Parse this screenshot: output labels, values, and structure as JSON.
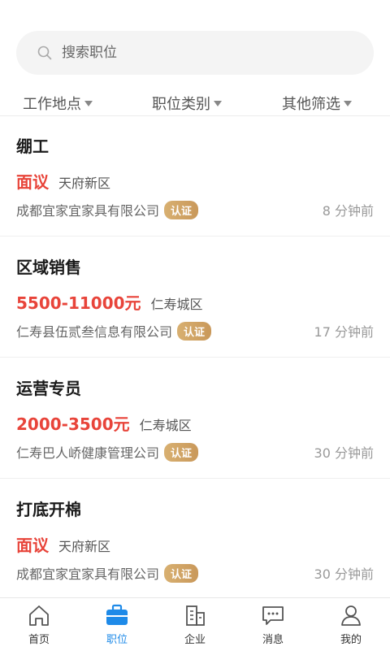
{
  "search": {
    "placeholder": "搜索职位"
  },
  "filters": [
    {
      "label": "工作地点"
    },
    {
      "label": "职位类别"
    },
    {
      "label": "其他筛选"
    }
  ],
  "jobs": [
    {
      "title": "绷工",
      "salary": "面议",
      "area": "天府新区",
      "company": "成都宜家宜家具有限公司",
      "badge": "认证",
      "time": "8 分钟前"
    },
    {
      "title": "区域销售",
      "salary": "5500-11000元",
      "area": "仁寿城区",
      "company": "仁寿县伍贰叁信息有限公司",
      "badge": "认证",
      "time": "17 分钟前"
    },
    {
      "title": "运营专员",
      "salary": "2000-3500元",
      "area": "仁寿城区",
      "company": "仁寿巴人峤健康管理公司",
      "badge": "认证",
      "time": "30 分钟前"
    },
    {
      "title": "打底开棉",
      "salary": "面议",
      "area": "天府新区",
      "company": "成都宜家宜家具有限公司",
      "badge": "认证",
      "time": "30 分钟前"
    }
  ],
  "tabs": [
    {
      "label": "首页",
      "icon": "home-icon"
    },
    {
      "label": "职位",
      "icon": "briefcase-icon"
    },
    {
      "label": "企业",
      "icon": "building-icon"
    },
    {
      "label": "消息",
      "icon": "message-icon"
    },
    {
      "label": "我的",
      "icon": "user-icon"
    }
  ],
  "colors": {
    "accent": "#1e8ae8",
    "salary": "#e8443a",
    "badge": "#c9985a"
  }
}
